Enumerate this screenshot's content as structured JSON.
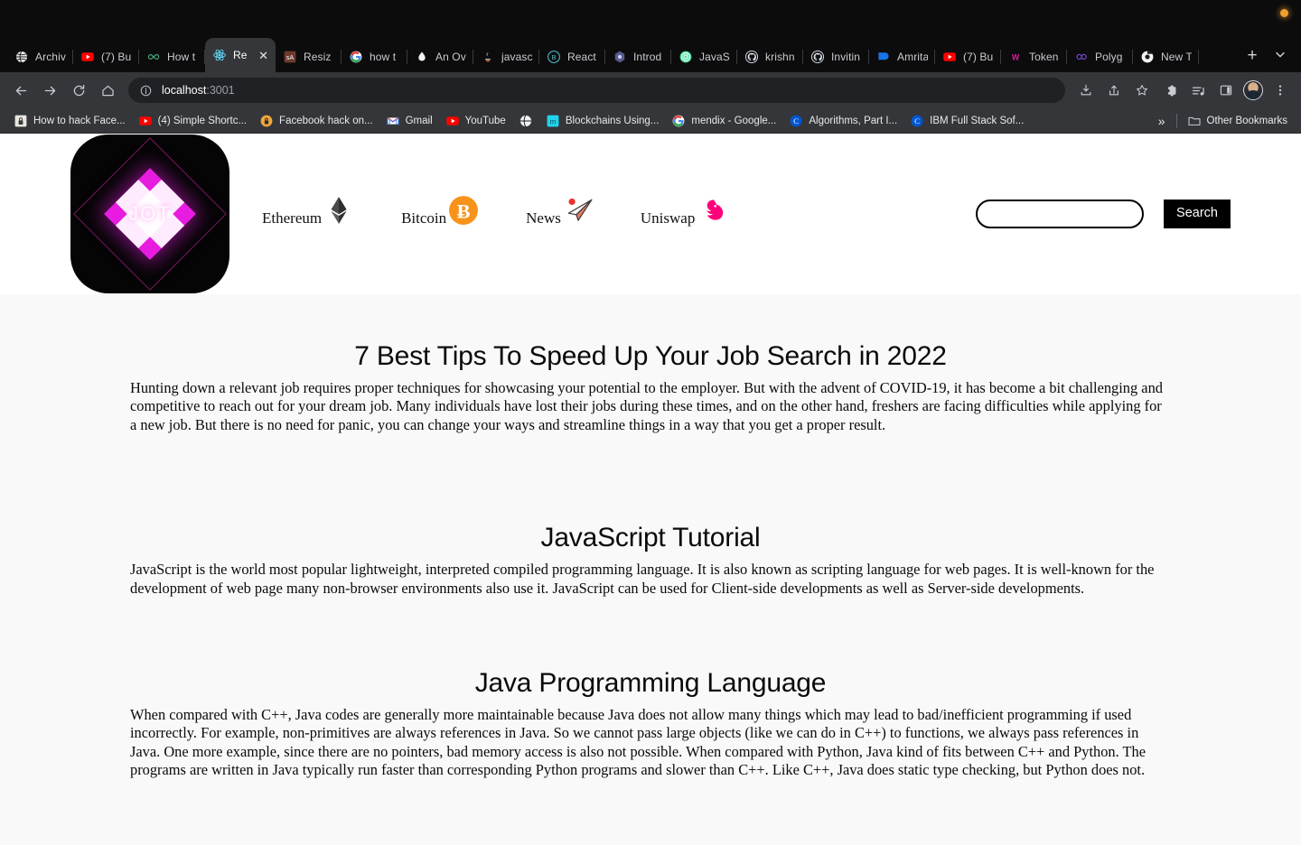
{
  "browser": {
    "window_dot": "orange-indicator",
    "tabs": [
      {
        "title": "Archiv",
        "icon": "globe-dark-icon",
        "active": false
      },
      {
        "title": "(7) Bu",
        "icon": "youtube-icon",
        "active": false
      },
      {
        "title": "How t",
        "icon": "infinity-green-icon",
        "active": false
      },
      {
        "title": "Re",
        "icon": "react-icon",
        "active": true
      },
      {
        "title": "Resiz",
        "icon": "sa-icon",
        "active": false
      },
      {
        "title": "how t",
        "icon": "google-icon",
        "active": false
      },
      {
        "title": "An Ov",
        "icon": "water-drop-icon",
        "active": false
      },
      {
        "title": "javasc",
        "icon": "java-icon",
        "active": false
      },
      {
        "title": "React",
        "icon": "bit-icon",
        "active": false
      },
      {
        "title": "Introd",
        "icon": "hexagon-icon",
        "active": false
      },
      {
        "title": "JavaS",
        "icon": "fingerprint-icon",
        "active": false
      },
      {
        "title": "krishn",
        "icon": "github-icon",
        "active": false
      },
      {
        "title": "Invitin",
        "icon": "github-icon",
        "active": false
      },
      {
        "title": "Amrita",
        "icon": "blue-square-icon",
        "active": false
      },
      {
        "title": "(7) Bu",
        "icon": "youtube-icon",
        "active": false
      },
      {
        "title": "Token",
        "icon": "w-magenta-icon",
        "active": false
      },
      {
        "title": "Polyg",
        "icon": "polygon-icon",
        "active": false
      },
      {
        "title": "New T",
        "icon": "chrome-icon",
        "active": false
      }
    ],
    "new_tab_label": "+",
    "tab_close_label": "✕",
    "toolbar": {
      "back_label": "back-arrow",
      "forward_label": "forward-arrow",
      "reload_label": "reload",
      "home_label": "home",
      "url_host": "localhost",
      "url_port": ":3001",
      "url_full": "localhost:3001",
      "site_info_label": "site-information",
      "install_label": "install-app",
      "share_label": "share",
      "bookmark_label": "bookmark-star",
      "extensions_label": "extensions",
      "reading_list_label": "reading-list",
      "side_panel_label": "side-panel",
      "profile_label": "profile-avatar",
      "menu_label": "chrome-menu"
    },
    "bookmarks": [
      {
        "title": "How to hack Face...",
        "icon": "lock-icon"
      },
      {
        "title": "(4) Simple Shortc...",
        "icon": "youtube-icon"
      },
      {
        "title": "Facebook hack on...",
        "icon": "orange-lock-icon"
      },
      {
        "title": "Gmail",
        "icon": "gmail-icon"
      },
      {
        "title": "YouTube",
        "icon": "youtube-icon"
      },
      {
        "title": "",
        "icon": "globe-icon"
      },
      {
        "title": "Blockchains Using...",
        "icon": "cyan-m-icon"
      },
      {
        "title": "mendix - Google...",
        "icon": "google-icon"
      },
      {
        "title": "Algorithms, Part I...",
        "icon": "coursera-icon"
      },
      {
        "title": "IBM Full Stack Sof...",
        "icon": "coursera-icon"
      }
    ],
    "bookmarks_overflow_label": "»",
    "other_bookmarks_label": "Other Bookmarks",
    "other_bookmarks_icon": "folder-icon"
  },
  "site": {
    "logo": {
      "text": "JOT",
      "icon": "jot-diamond-logo",
      "bg_color": "#050505",
      "accent_color": "#e81ce0"
    },
    "nav": [
      {
        "label": "Ethereum",
        "icon": "ethereum-icon"
      },
      {
        "label": "Bitcoin",
        "icon": "bitcoin-icon"
      },
      {
        "label": "News",
        "icon": "paper-plane-icon"
      },
      {
        "label": "Uniswap",
        "icon": "uniswap-unicorn-icon"
      }
    ],
    "search": {
      "value": "",
      "placeholder": "",
      "button_label": "Search"
    },
    "articles": [
      {
        "title": "7 Best Tips To Speed Up Your Job Search in 2022",
        "body": "Hunting down a relevant job requires proper techniques for showcasing your potential to the employer. But with the advent of COVID-19, it has become a bit challenging and competitive to reach out for your dream job. Many individuals have lost their jobs during these times, and on the other hand, freshers are facing difficulties while applying for a new job. But there is no need for panic, you can change your ways and streamline things in a way that you get a proper result."
      },
      {
        "title": "JavaScript Tutorial",
        "body": "JavaScript is the world most popular lightweight, interpreted compiled programming language. It is also known as scripting language for web pages. It is well-known for the development of web page many non-browser environments also use it. JavaScript can be used for Client-side developments as well as Server-side developments."
      },
      {
        "title": "Java Programming Language",
        "body": "When compared with C++, Java codes are generally more maintainable because Java does not allow many things which may lead to bad/inefficient programming if used incorrectly. For example, non-primitives are always references in Java. So we cannot pass large objects (like we can do in C++) to functions, we always pass references in Java. One more example, since there are no pointers, bad memory access is also not possible. When compared with Python, Java kind of fits between C++ and Python. The programs are written in Java typically run faster than corresponding Python programs and slower than C++. Like C++, Java does static type checking, but Python does not."
      }
    ]
  }
}
